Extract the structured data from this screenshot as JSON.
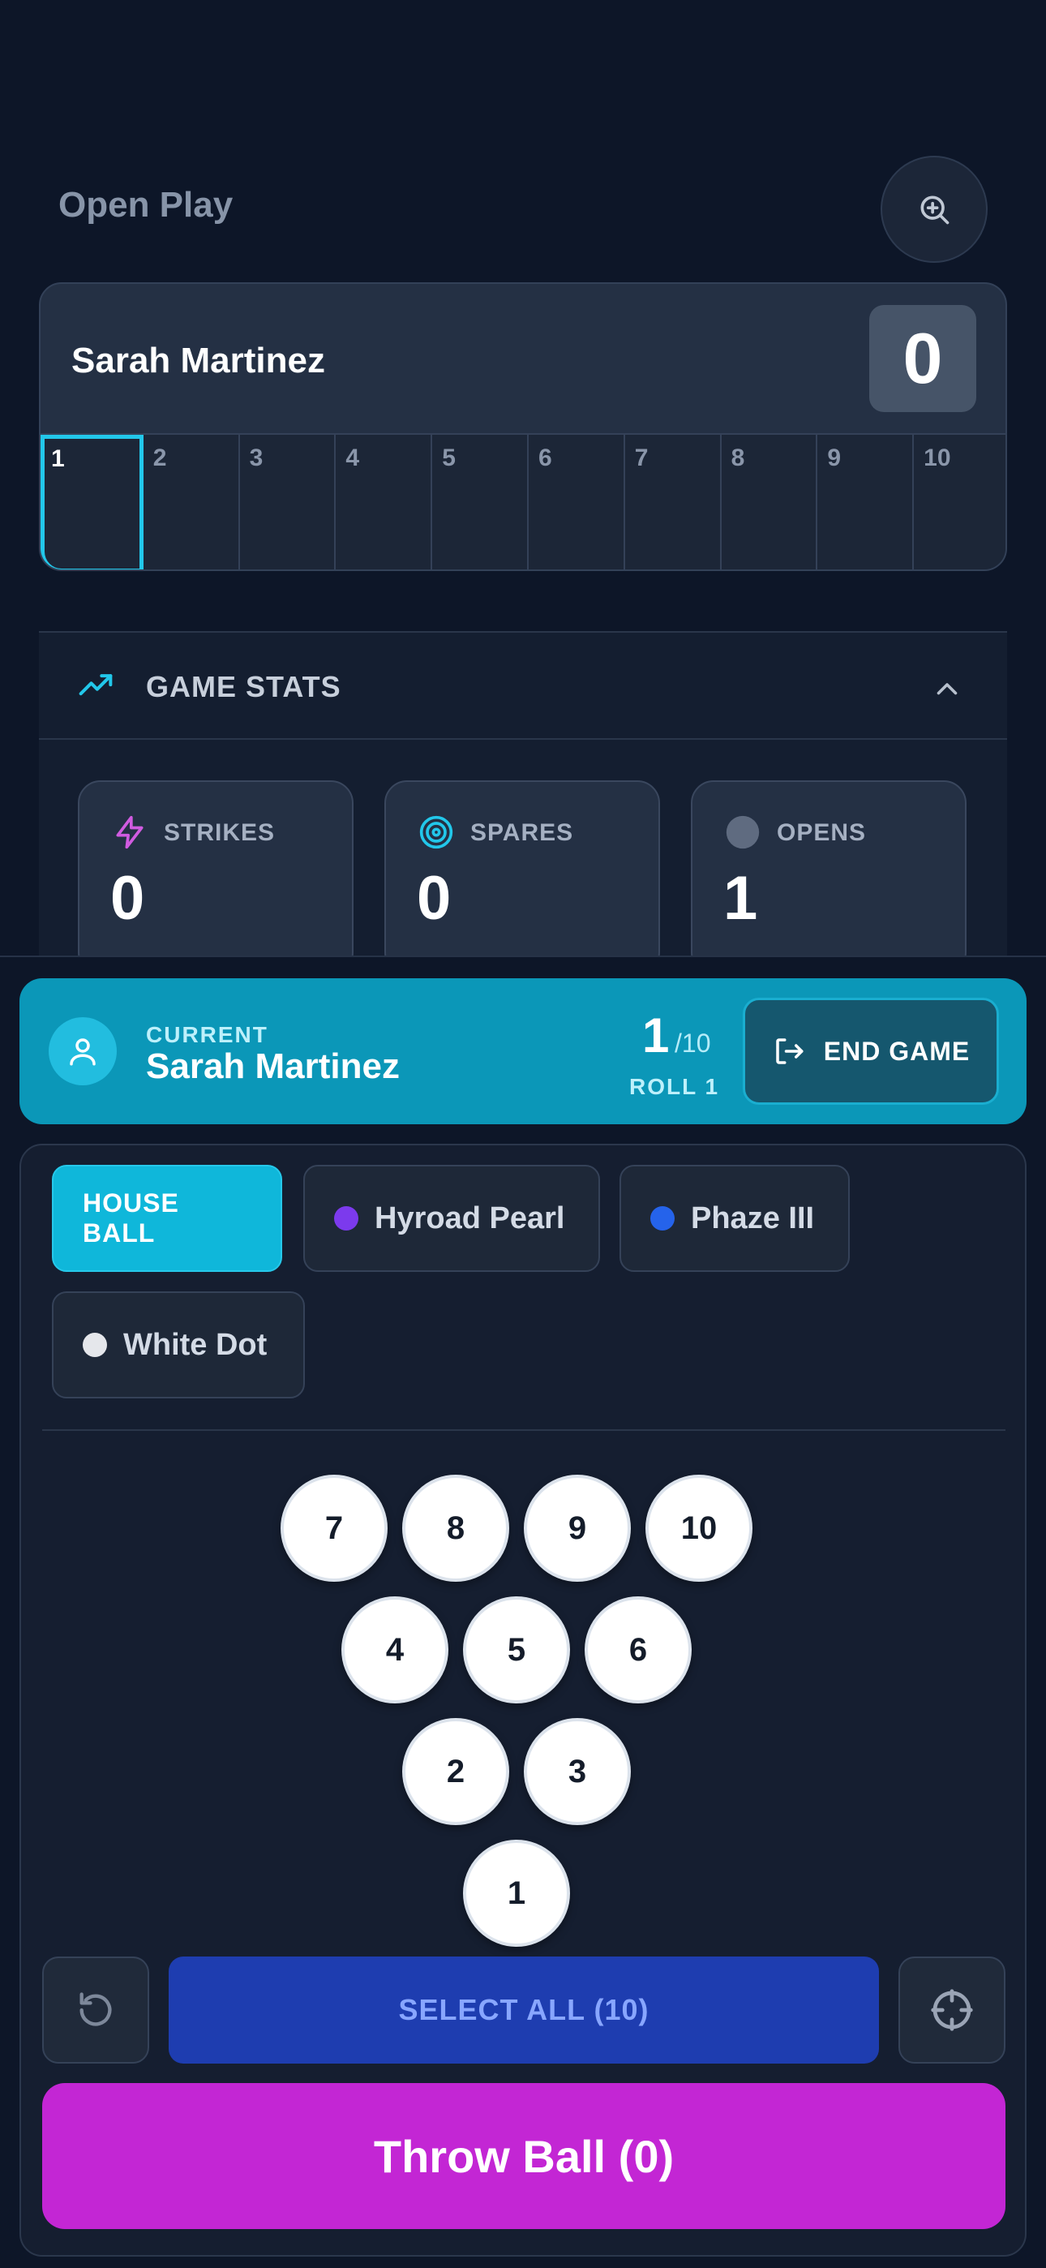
{
  "header": {
    "title": "Open Play",
    "zoom_icon": "zoom-in-icon"
  },
  "scorecard": {
    "player_name": "Sarah Martinez",
    "total_score": "0",
    "frames": [
      "1",
      "2",
      "3",
      "4",
      "5",
      "6",
      "7",
      "8",
      "9",
      "10"
    ],
    "active_frame": 1
  },
  "stats": {
    "title": "GAME STATS",
    "items": [
      {
        "label": "STRIKES",
        "value": "0",
        "icon": "lightning-icon",
        "color": "#d05be0"
      },
      {
        "label": "SPARES",
        "value": "0",
        "icon": "target-icon",
        "color": "#22c7ea"
      },
      {
        "label": "OPENS",
        "value": "1",
        "icon": "circle-icon",
        "color": "#5f6b80"
      }
    ]
  },
  "current": {
    "label": "CURRENT",
    "player_name": "Sarah Martinez",
    "frame": "1",
    "frame_total": "/10",
    "roll": "ROLL 1",
    "end_game_label": "END GAME"
  },
  "balls": [
    {
      "name": "HOUSE BALL",
      "selected": true
    },
    {
      "name": "Hyroad Pearl",
      "color": "#7c3aed"
    },
    {
      "name": "Phaze III",
      "color": "#2563eb"
    },
    {
      "name": "White Dot",
      "color": "#e5e7eb"
    }
  ],
  "pins": {
    "row4": [
      "7",
      "8",
      "9",
      "10"
    ],
    "row3": [
      "4",
      "5",
      "6"
    ],
    "row2": [
      "2",
      "3"
    ],
    "row1": [
      "1"
    ]
  },
  "controls": {
    "reset_icon": "reset-icon",
    "select_all_label": "SELECT ALL (10)",
    "crosshair_icon": "crosshair-icon",
    "throw_label": "Throw Ball (0)"
  },
  "colors": {
    "accent": "#0fb7da",
    "throw": "#c326d4",
    "select_all": "#1e3db0",
    "background": "#0d1628"
  }
}
